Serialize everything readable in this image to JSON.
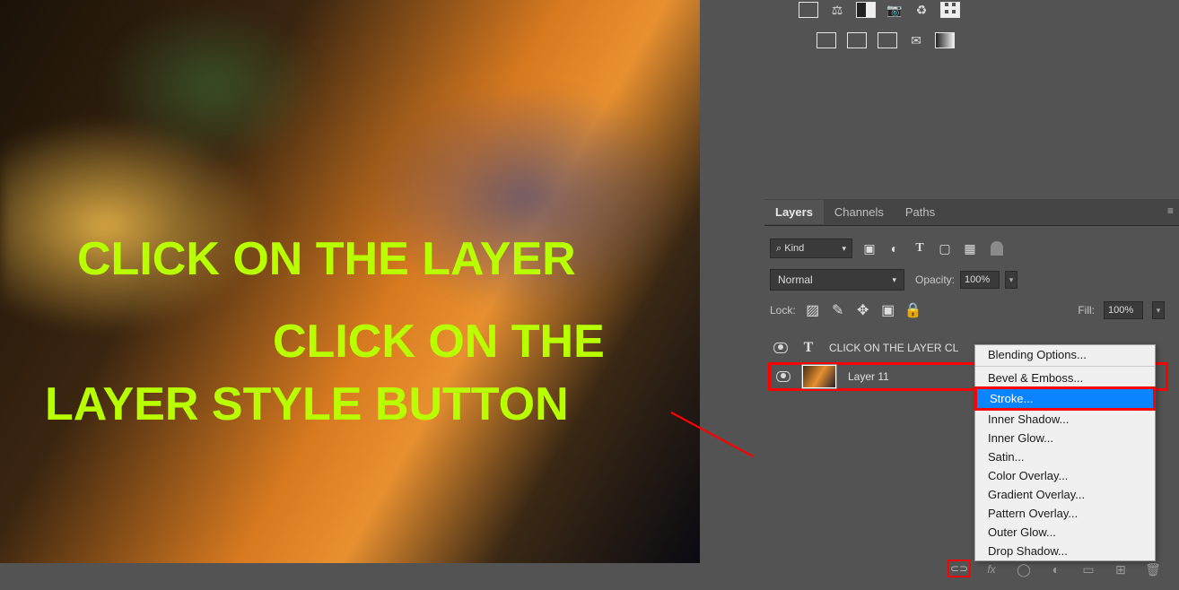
{
  "canvas": {
    "line1": "CLICK ON THE LAYER",
    "line2": "CLICK ON THE",
    "line3": "LAYER STYLE BUTTON"
  },
  "panel": {
    "tabs": {
      "layers": "Layers",
      "channels": "Channels",
      "paths": "Paths"
    },
    "filter": {
      "kind": "Kind",
      "search_prefix": "⌕"
    },
    "blend": {
      "mode": "Normal",
      "opacity_label": "Opacity:",
      "opacity_value": "100%"
    },
    "lock": {
      "label": "Lock:",
      "fill_label": "Fill:",
      "fill_value": "100%"
    },
    "layers": [
      {
        "name": "CLICK ON THE LAYER CL",
        "type": "T"
      },
      {
        "name": "Layer 11",
        "type": "img"
      }
    ]
  },
  "menu": {
    "items": [
      "Blending Options...",
      "Bevel & Emboss...",
      "Stroke...",
      "Inner Shadow...",
      "Inner Glow...",
      "Satin...",
      "Color Overlay...",
      "Gradient Overlay...",
      "Pattern Overlay...",
      "Outer Glow...",
      "Drop Shadow..."
    ]
  }
}
